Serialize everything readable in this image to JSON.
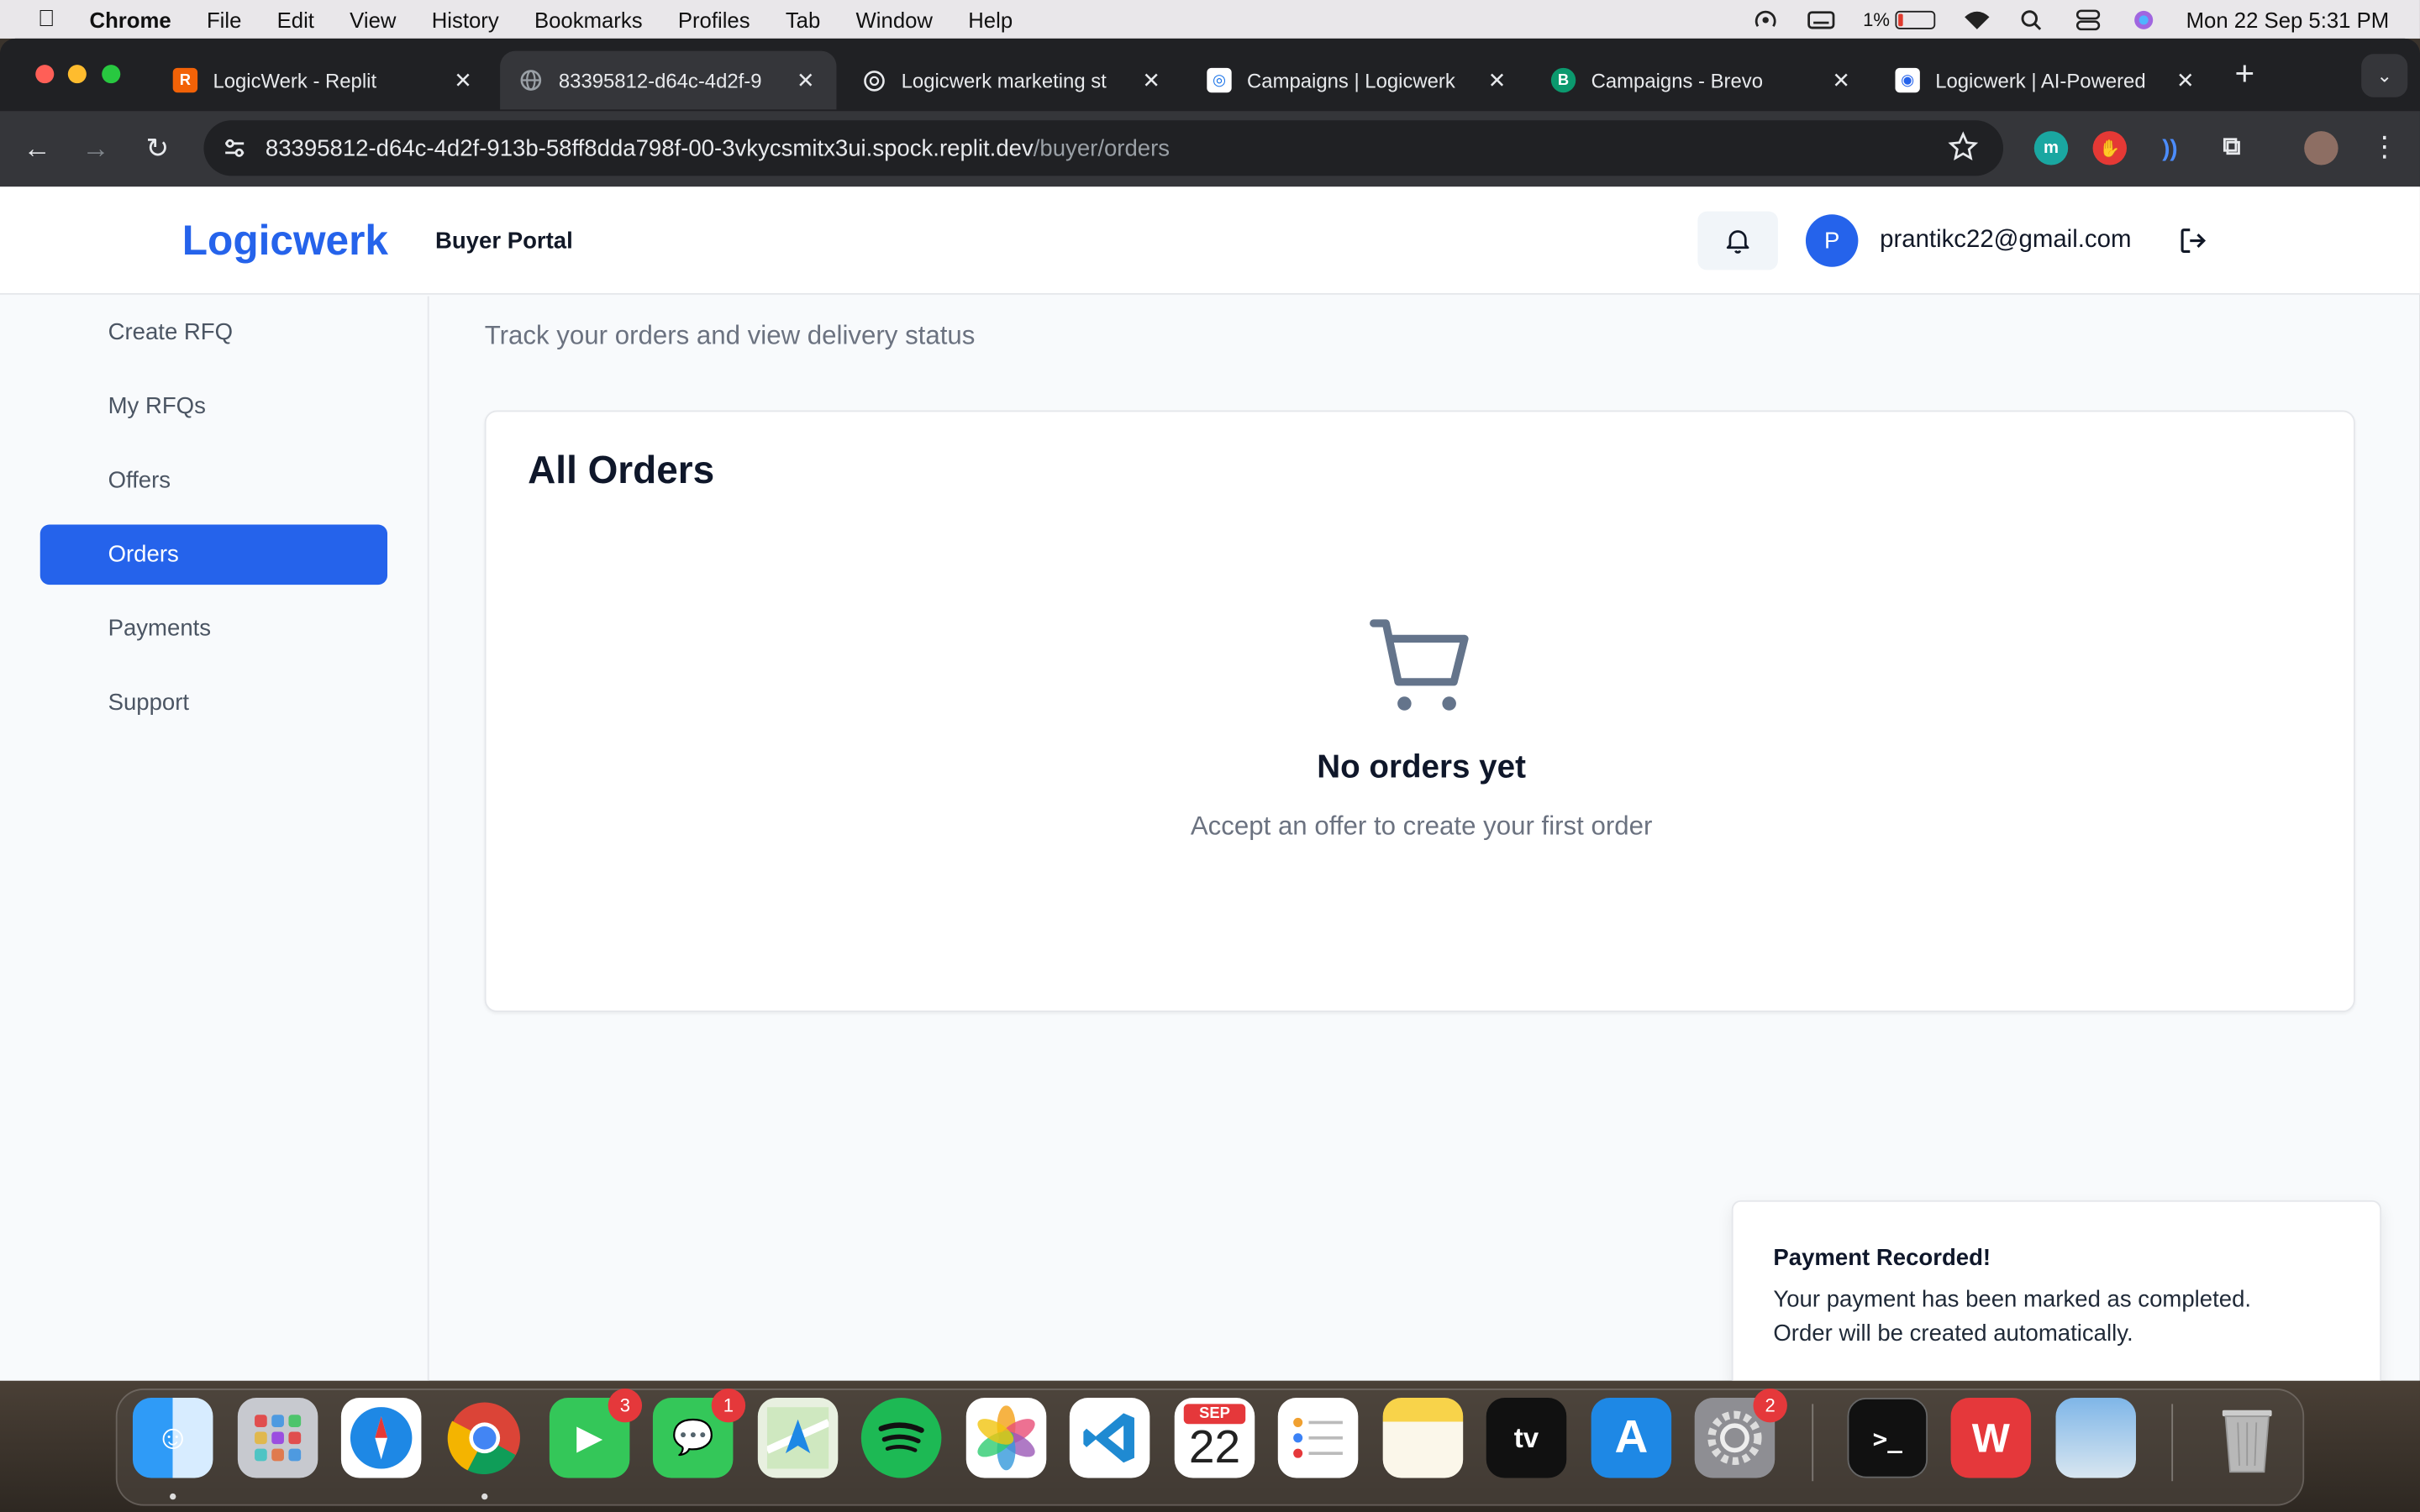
{
  "menubar": {
    "app": "Chrome",
    "items": [
      "File",
      "Edit",
      "View",
      "History",
      "Bookmarks",
      "Profiles",
      "Tab",
      "Window",
      "Help"
    ],
    "battery": "1%",
    "clock": "Mon 22 Sep  5:31 PM"
  },
  "tabs": [
    {
      "title": "LogicWerk - Replit"
    },
    {
      "title": "83395812-d64c-4d2f-9"
    },
    {
      "title": "Logicwerk marketing st"
    },
    {
      "title": "Campaigns | Logicwerk"
    },
    {
      "title": "Campaigns - Brevo"
    },
    {
      "title": "Logicwerk | AI-Powered"
    }
  ],
  "address": {
    "host": "83395812-d64c-4d2f-913b-58ff8dda798f-00-3vkycsmitx3ui.spock.replit.dev",
    "path": "/buyer/orders"
  },
  "header": {
    "logo": "Logicwerk",
    "portal": "Buyer Portal",
    "avatar_initial": "P",
    "email": "prantikc22@gmail.com"
  },
  "sidebar": {
    "items": [
      {
        "label": "Create RFQ"
      },
      {
        "label": "My RFQs"
      },
      {
        "label": "Offers"
      },
      {
        "label": "Orders"
      },
      {
        "label": "Payments"
      },
      {
        "label": "Support"
      }
    ],
    "active": "Orders"
  },
  "main": {
    "subtitle": "Track your orders and view delivery status",
    "card_title": "All Orders",
    "empty_title": "No orders yet",
    "empty_subtitle": "Accept an offer to create your first order"
  },
  "toast": {
    "title": "Payment Recorded!",
    "line1": "Your payment has been marked as completed.",
    "line2": "Order will be created automatically."
  },
  "dock": {
    "calendar_month": "SEP",
    "calendar_day": "22",
    "facetime_badge": "3",
    "messages_badge": "1",
    "settings_badge": "2",
    "tv_label": "tv"
  },
  "colors": {
    "accent": "#2563eb",
    "muted_text": "#6b7280"
  }
}
